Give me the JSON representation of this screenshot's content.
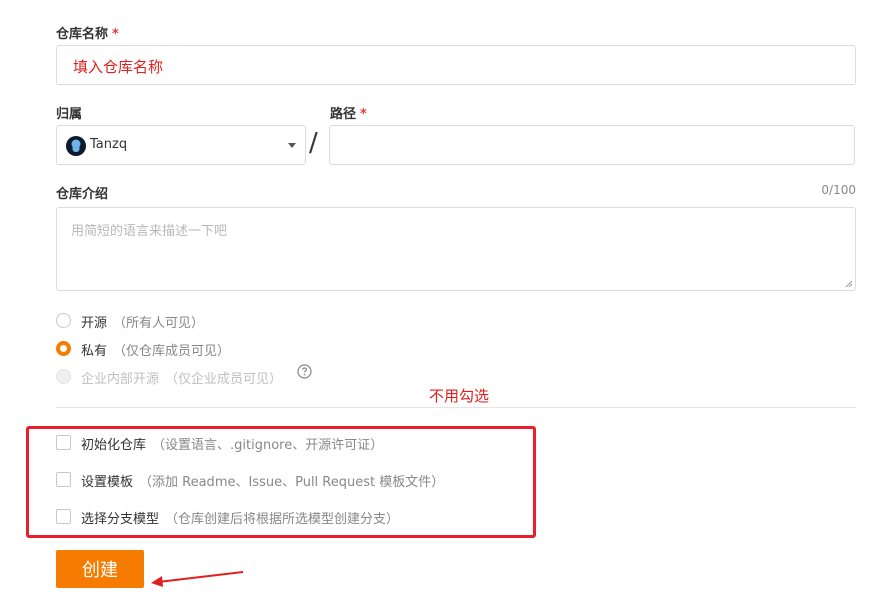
{
  "repo_name": {
    "label": "仓库名称",
    "required_mark": "*",
    "annotation": "填入仓库名称"
  },
  "owner": {
    "label": "归属",
    "selected": "Tanzq"
  },
  "separator": "/",
  "path": {
    "label": "路径",
    "required_mark": "*",
    "value": ""
  },
  "description": {
    "label": "仓库介绍",
    "counter": "0/100",
    "placeholder": "用简短的语言来描述一下吧"
  },
  "visibility": {
    "options": [
      {
        "label": "开源",
        "hint": "（所有人可见）",
        "checked": false,
        "disabled": false
      },
      {
        "label": "私有",
        "hint": "（仅仓库成员可见）",
        "checked": true,
        "disabled": false
      },
      {
        "label": "企业内部开源",
        "hint": "（仅企业成员可见）",
        "checked": false,
        "disabled": true
      }
    ],
    "help_icon": "question-circle-icon"
  },
  "annotation_no_check": "不用勾选",
  "init_options": [
    {
      "label": "初始化仓库",
      "hint": "（设置语言、.gitignore、开源许可证）"
    },
    {
      "label": "设置模板",
      "hint": "（添加 Readme、Issue、Pull Request 模板文件）"
    },
    {
      "label": "选择分支模型",
      "hint": "（仓库创建后将根据所选模型创建分支）"
    }
  ],
  "create_button": "创建",
  "colors": {
    "accent": "#f57c00",
    "annotation": "#e02020"
  }
}
